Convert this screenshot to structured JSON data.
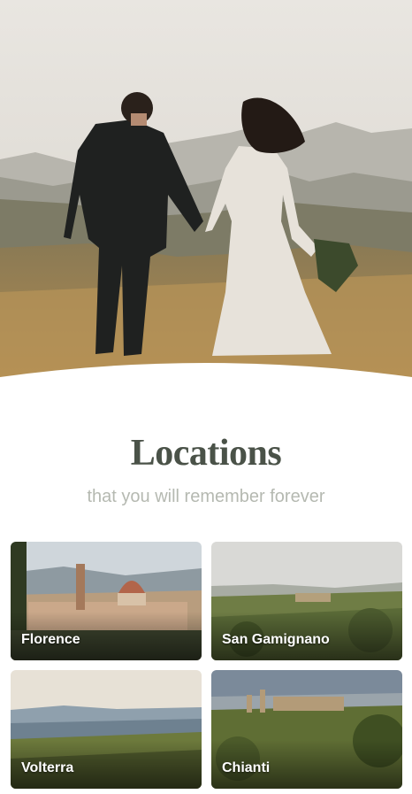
{
  "section": {
    "title": "Locations",
    "subtitle": "that you will remember forever"
  },
  "locations": [
    {
      "name": "Florence"
    },
    {
      "name": "San Gamignano"
    },
    {
      "name": "Volterra"
    },
    {
      "name": "Chianti"
    }
  ],
  "colors": {
    "title": "#4a5248",
    "subtitle": "#b5b9b1",
    "background": "#ffffff"
  }
}
